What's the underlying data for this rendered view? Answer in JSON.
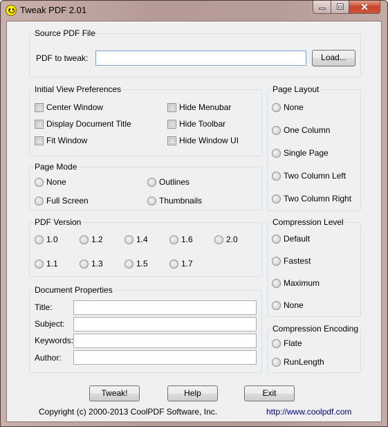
{
  "window": {
    "title": "Tweak PDF 2.01",
    "icon": "smiley-icon",
    "controls": {
      "minimize": "minimize-icon",
      "maximize": "maximize-icon",
      "close": "close-icon",
      "close_glyph": "✕"
    }
  },
  "source": {
    "legend": "Source PDF File",
    "label": "PDF to tweak:",
    "value": "",
    "load_label": "Load..."
  },
  "initial_view": {
    "legend": "Initial View Preferences",
    "options": [
      {
        "label": "Center Window",
        "checked": false
      },
      {
        "label": "Display Document Title",
        "checked": false
      },
      {
        "label": "Fit Window",
        "checked": false
      },
      {
        "label": "Hide Menubar",
        "checked": false
      },
      {
        "label": "Hide Toolbar",
        "checked": false
      },
      {
        "label": "Hide Window UI",
        "checked": false
      }
    ]
  },
  "page_layout": {
    "legend": "Page Layout",
    "options": [
      "None",
      "One Column",
      "Single Page",
      "Two Column Left",
      "Two Column Right"
    ]
  },
  "page_mode": {
    "legend": "Page Mode",
    "options": [
      "None",
      "Full Screen",
      "Outlines",
      "Thumbnails"
    ]
  },
  "pdf_version": {
    "legend": "PDF Version",
    "options": [
      "1.0",
      "1.1",
      "1.2",
      "1.3",
      "1.4",
      "1.5",
      "1.6",
      "1.7",
      "2.0"
    ]
  },
  "compression_level": {
    "legend": "Compression Level",
    "options": [
      "Default",
      "Fastest",
      "Maximum",
      "None"
    ]
  },
  "compression_encoding": {
    "legend": "Compression Encoding",
    "options": [
      "Flate",
      "RunLength"
    ]
  },
  "document_properties": {
    "legend": "Document Properties",
    "fields": [
      {
        "label": "Title:",
        "value": ""
      },
      {
        "label": "Subject:",
        "value": ""
      },
      {
        "label": "Keywords:",
        "value": ""
      },
      {
        "label": "Author:",
        "value": ""
      }
    ]
  },
  "actions": {
    "tweak": "Tweak!",
    "help": "Help",
    "exit": "Exit"
  },
  "footer": {
    "copyright": "Copyright (c) 2000-2013 CoolPDF Software, Inc.",
    "link": "http://www.coolpdf.com",
    "link_color": "#000080"
  }
}
